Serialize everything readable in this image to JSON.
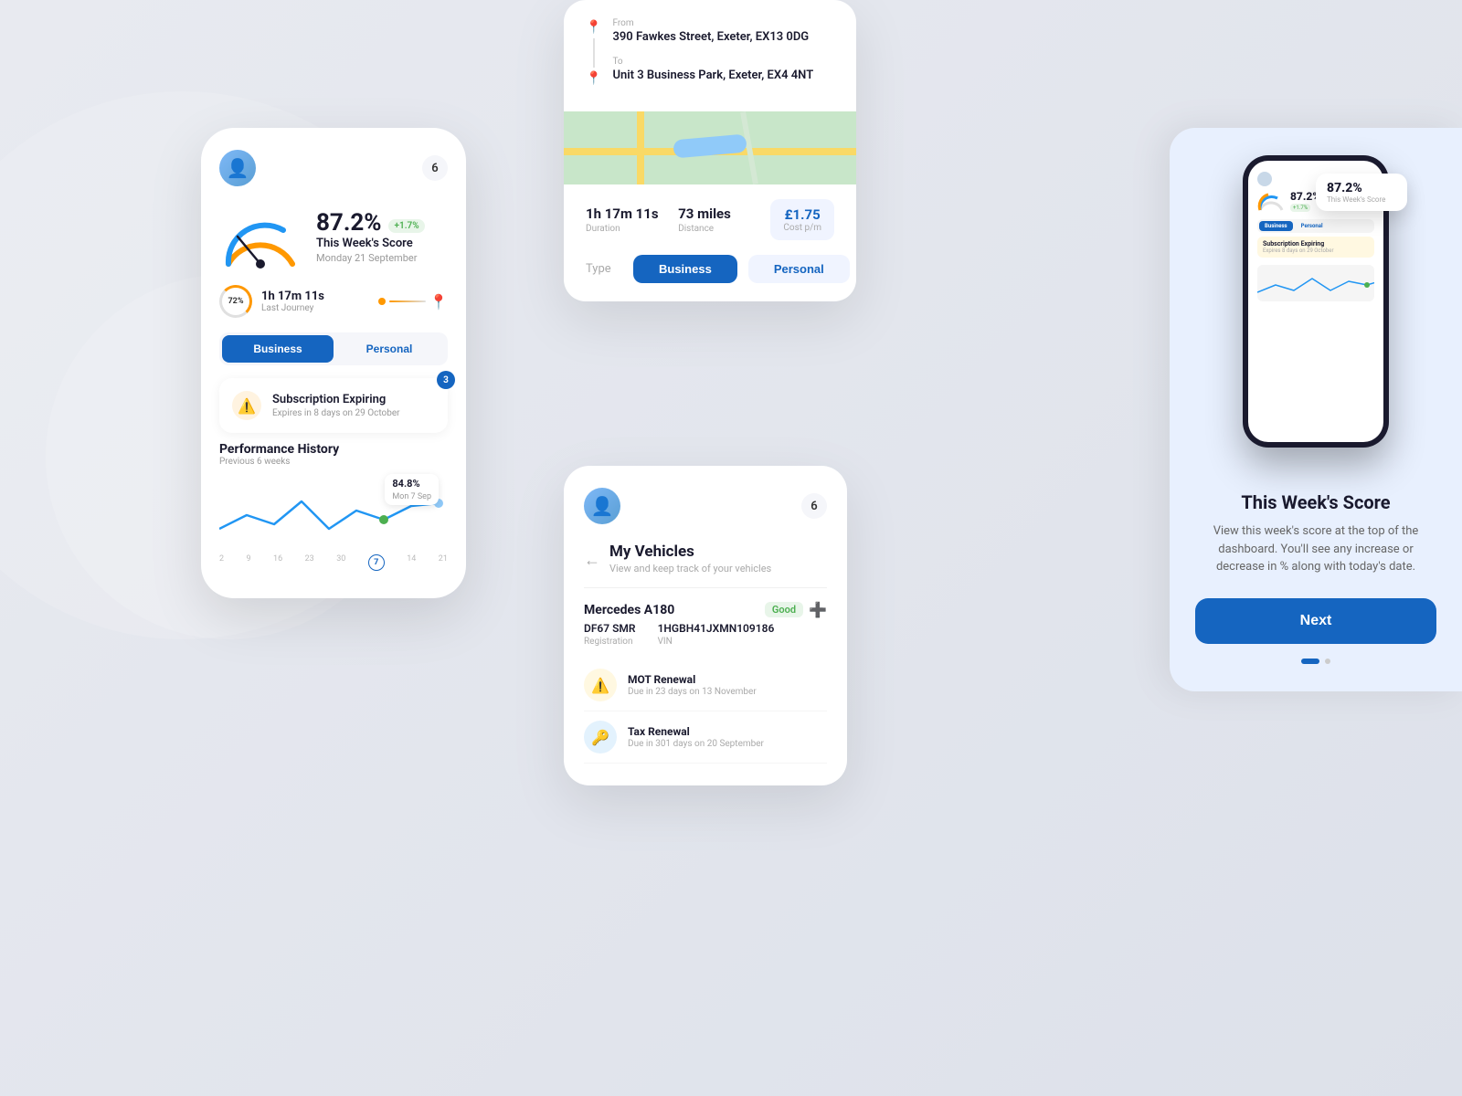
{
  "background": {
    "color": "#dde1ea"
  },
  "card1": {
    "badge": "6",
    "score_percent": "87.2%",
    "score_change": "+1.7%",
    "score_label": "This Week's Score",
    "score_date": "Monday 21 September",
    "journey_time": "1h 17m 11s",
    "journey_label": "Last Journey",
    "journey_circle": "72%",
    "toggle_business": "Business",
    "toggle_personal": "Personal",
    "subscription_title": "Subscription Expiring",
    "subscription_subtitle": "Expires in 8 days on 29 October",
    "subscription_badge": "3",
    "perf_title": "Performance History",
    "perf_sub": "Previous 6 weeks",
    "chart_tooltip_value": "84.8%",
    "chart_tooltip_date": "Mon 7 Sep",
    "chart_x_labels": [
      "2",
      "9",
      "16",
      "23",
      "30",
      "7",
      "14",
      "21"
    ]
  },
  "route_card": {
    "from_label": "From",
    "from_address": "390 Fawkes Street, Exeter, EX13 0DG",
    "to_label": "To",
    "to_address": "Unit 3 Business Park, Exeter, EX4 4NT",
    "duration_value": "1h 17m 11s",
    "duration_label": "Duration",
    "distance_value": "73 miles",
    "distance_label": "Distance",
    "cost_value": "£1.75",
    "cost_label": "Cost p/m",
    "type_label": "Type",
    "type_business": "Business",
    "type_personal": "Personal"
  },
  "vehicles_card": {
    "back_arrow": "←",
    "title": "My Vehicles",
    "subtitle": "View and keep track of your vehicles",
    "vehicle_name": "Mercedes A180",
    "good_label": "Good",
    "registration_label": "Registration",
    "registration_value": "DF67 SMR",
    "vin_label": "VIN",
    "vin_value": "1HGBH41JXMN109186",
    "mot_title": "MOT Renewal",
    "mot_due": "Due in 23 days on 13 November",
    "tax_title": "Tax Renewal",
    "tax_due": "Due in 301 days on 20 September",
    "header_badge": "6"
  },
  "right_card": {
    "title": "This Week's Score",
    "description": "View this week's score at the top of the dashboard. You'll see any increase or decrease in % along with today's date.",
    "next_button": "Next",
    "phone_score": "87.2%",
    "phone_score_badge": "+1.7%"
  }
}
